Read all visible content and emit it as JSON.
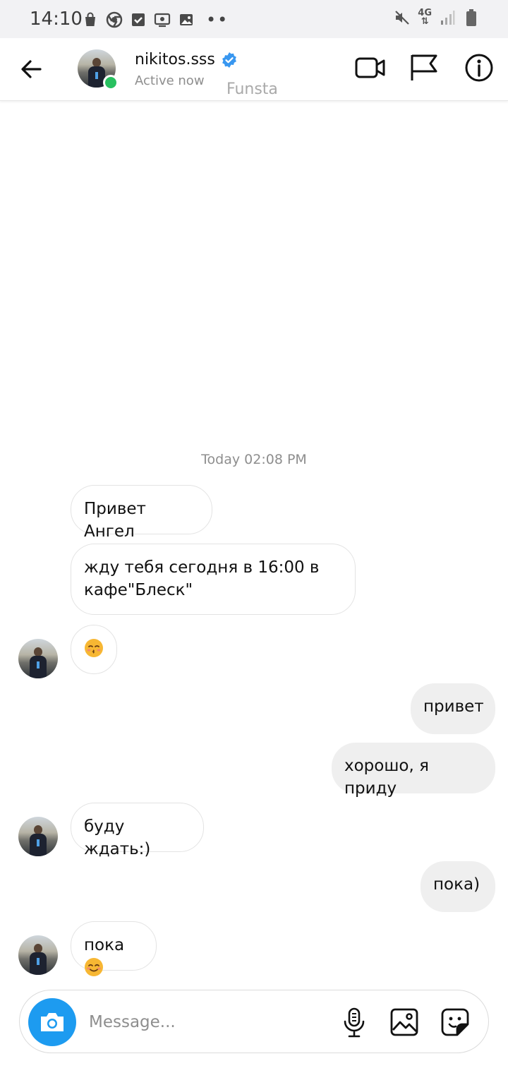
{
  "status_bar": {
    "time": "14:10",
    "network": "4G"
  },
  "header": {
    "username": "nikitos.sss",
    "status": "Active now",
    "watermark": "Funsta"
  },
  "chat": {
    "timestamp": "Today 02:08 PM",
    "messages": [
      {
        "side": "incoming",
        "text": "Привет Ангел"
      },
      {
        "side": "incoming",
        "text_line1": "жду тебя сегодня в 16:00 в",
        "text_line2": "кафе\"Блеск\""
      },
      {
        "side": "incoming",
        "emoji": "kissing-face-emoji"
      },
      {
        "side": "outgoing",
        "text": "привет"
      },
      {
        "side": "outgoing",
        "text": "хорошо, я приду"
      },
      {
        "side": "incoming",
        "text": "буду ждать:)"
      },
      {
        "side": "outgoing",
        "text": "пока)"
      },
      {
        "side": "incoming",
        "text": "пока",
        "emoji": "smiling-face-emoji"
      }
    ]
  },
  "composer": {
    "placeholder": "Message..."
  },
  "colors": {
    "accent": "#1d9bf0",
    "online": "#28c060",
    "verified": "#3897f0",
    "outgoing_bubble": "#efefef"
  }
}
